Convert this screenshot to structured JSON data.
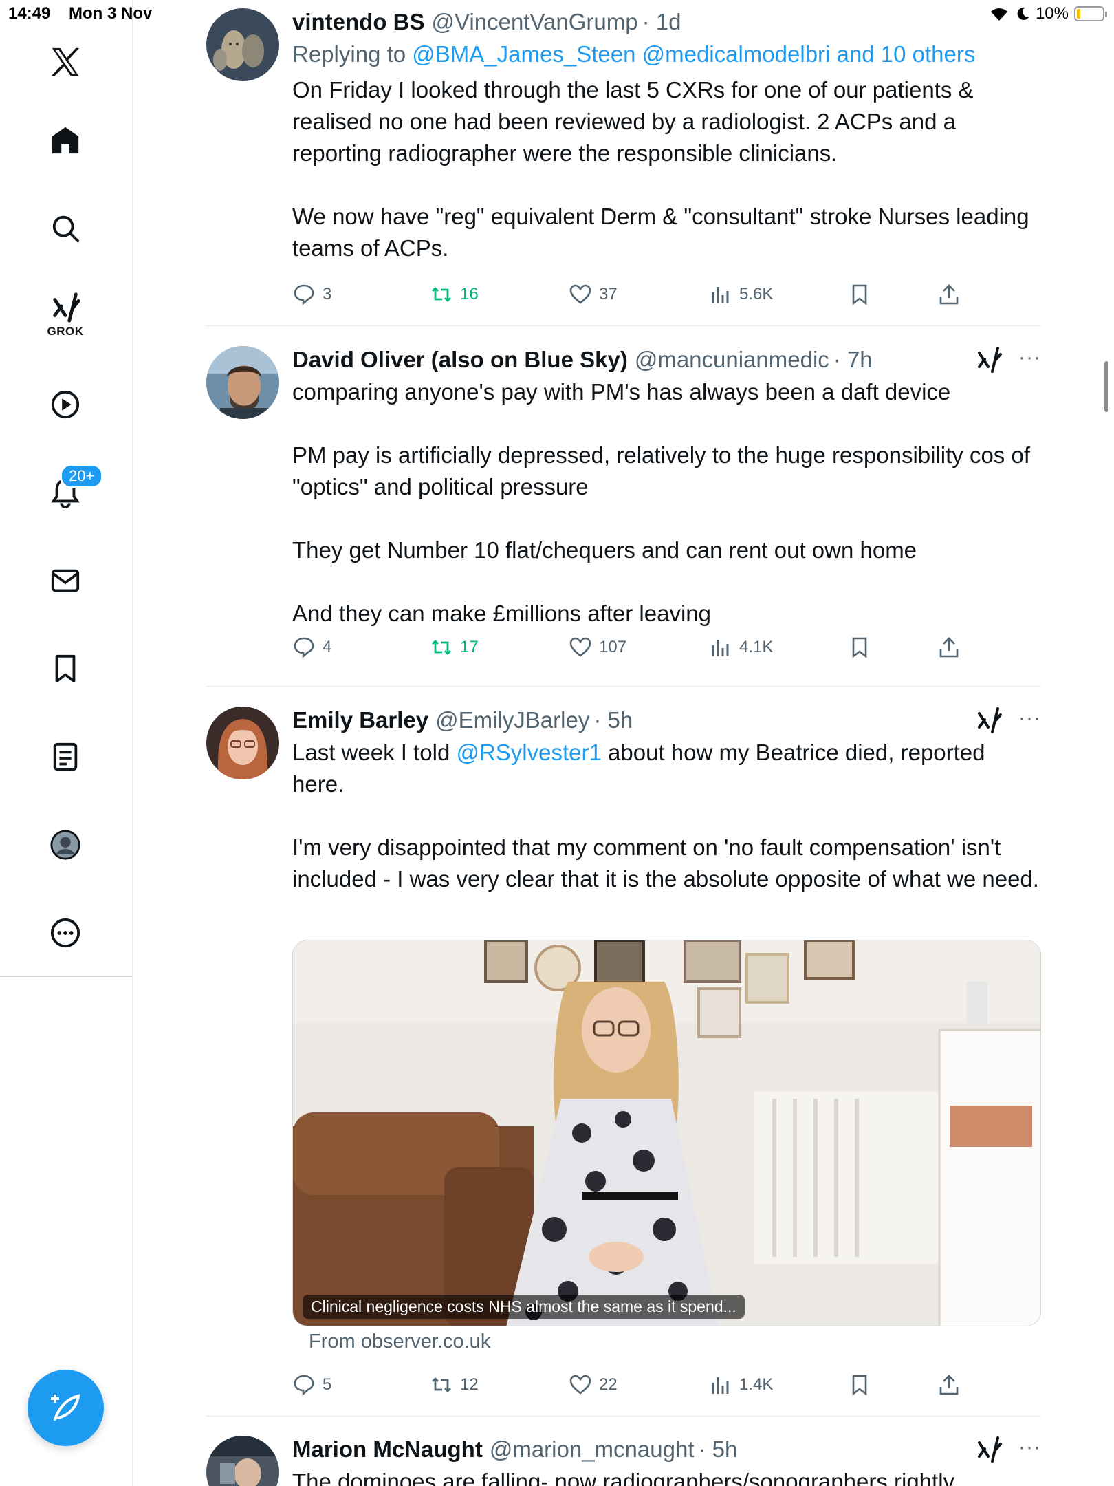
{
  "status": {
    "time": "14:49",
    "date": "Mon 3 Nov",
    "battery": "10%",
    "battery_level": 0.1
  },
  "sidebar": {
    "grok_label": "GROK",
    "notifications_badge": "20+",
    "items": [
      "x-logo",
      "home-icon",
      "search-icon",
      "grok-icon",
      "video-icon",
      "bell-icon",
      "mail-icon",
      "bookmark-icon",
      "lists-icon",
      "profile-icon",
      "more-icon"
    ]
  },
  "tweets": [
    {
      "name": "vintendo BS",
      "handle": "@VincentVanGrump",
      "time": "· 1d",
      "reply_prefix": "Replying to",
      "reply_mentions": "@BMA_James_Steen @medicalmodelbri and 10 others",
      "body": "On Friday I looked through the last 5 CXRs for one of our patients & realised no one had been reviewed by a radiologist. 2 ACPs and a reporting radiographer were the responsible clinicians.\n\nWe now have \"reg\" equivalent Derm & \"consultant\" stroke Nurses leading teams of ACPs.",
      "replies": "3",
      "reposts": "16",
      "likes": "37",
      "views": "5.6K"
    },
    {
      "name": "David Oliver (also on Blue Sky)",
      "handle": "@mancunianmedic",
      "time": "· 7h",
      "body": "comparing anyone's pay with PM's has always been a daft device\n\nPM pay is artificially depressed, relatively to the huge responsibility cos of \"optics\" and political pressure\n\nThey get Number 10 flat/chequers and can rent out own home\n\nAnd they can make £millions after leaving",
      "replies": "4",
      "reposts": "17",
      "likes": "107",
      "views": "4.1K"
    },
    {
      "name": "Emily Barley",
      "handle": "@EmilyJBarley",
      "time": "· 5h",
      "body_before": "Last week I told ",
      "body_mention": "@RSylvester1",
      "body_after": " about how my Beatrice died, reported here.\n\nI'm very disappointed that my comment on 'no fault compensation' isn't included - I was very clear that it is the absolute opposite of what we need.",
      "media_caption": "Clinical negligence costs NHS almost the same as it spend...",
      "media_from": "From observer.co.uk",
      "replies": "5",
      "reposts": "12",
      "likes": "22",
      "views": "1.4K"
    },
    {
      "name": "Marion McNaught",
      "handle": "@marion_mcnaught",
      "time": "· 5h",
      "body": "The dominoes are falling- now radiographers/sonographers rightly"
    }
  ]
}
